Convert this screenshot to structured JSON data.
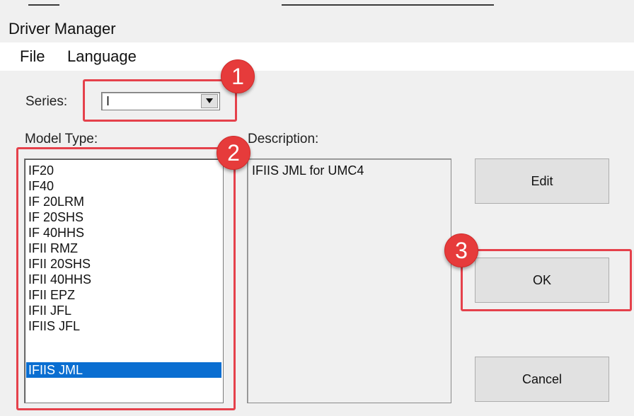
{
  "window": {
    "title": "Driver Manager"
  },
  "menu": {
    "file": "File",
    "language": "Language"
  },
  "series": {
    "label": "Series:",
    "value": "I"
  },
  "model_type": {
    "label": "Model Type:",
    "items": [
      "IF20",
      "IF40",
      "IF 20LRM",
      "IF 20SHS",
      "IF 40HHS",
      "IFII RMZ",
      "IFII 20SHS",
      "IFII 40HHS",
      "IFII EPZ",
      "IFII JFL",
      "IFIIS JFL",
      "IFIIS JML"
    ],
    "selected": "IFIIS JML"
  },
  "description": {
    "label": "Description:",
    "text": "IFIIS JML for UMC4"
  },
  "buttons": {
    "edit": "Edit",
    "ok": "OK",
    "cancel": "Cancel"
  },
  "callouts": {
    "one": "1",
    "two": "2",
    "three": "3",
    "color": "#e5414b"
  },
  "colors": {
    "selection": "#0a6ed1",
    "accent_red": "#e63b3b"
  }
}
